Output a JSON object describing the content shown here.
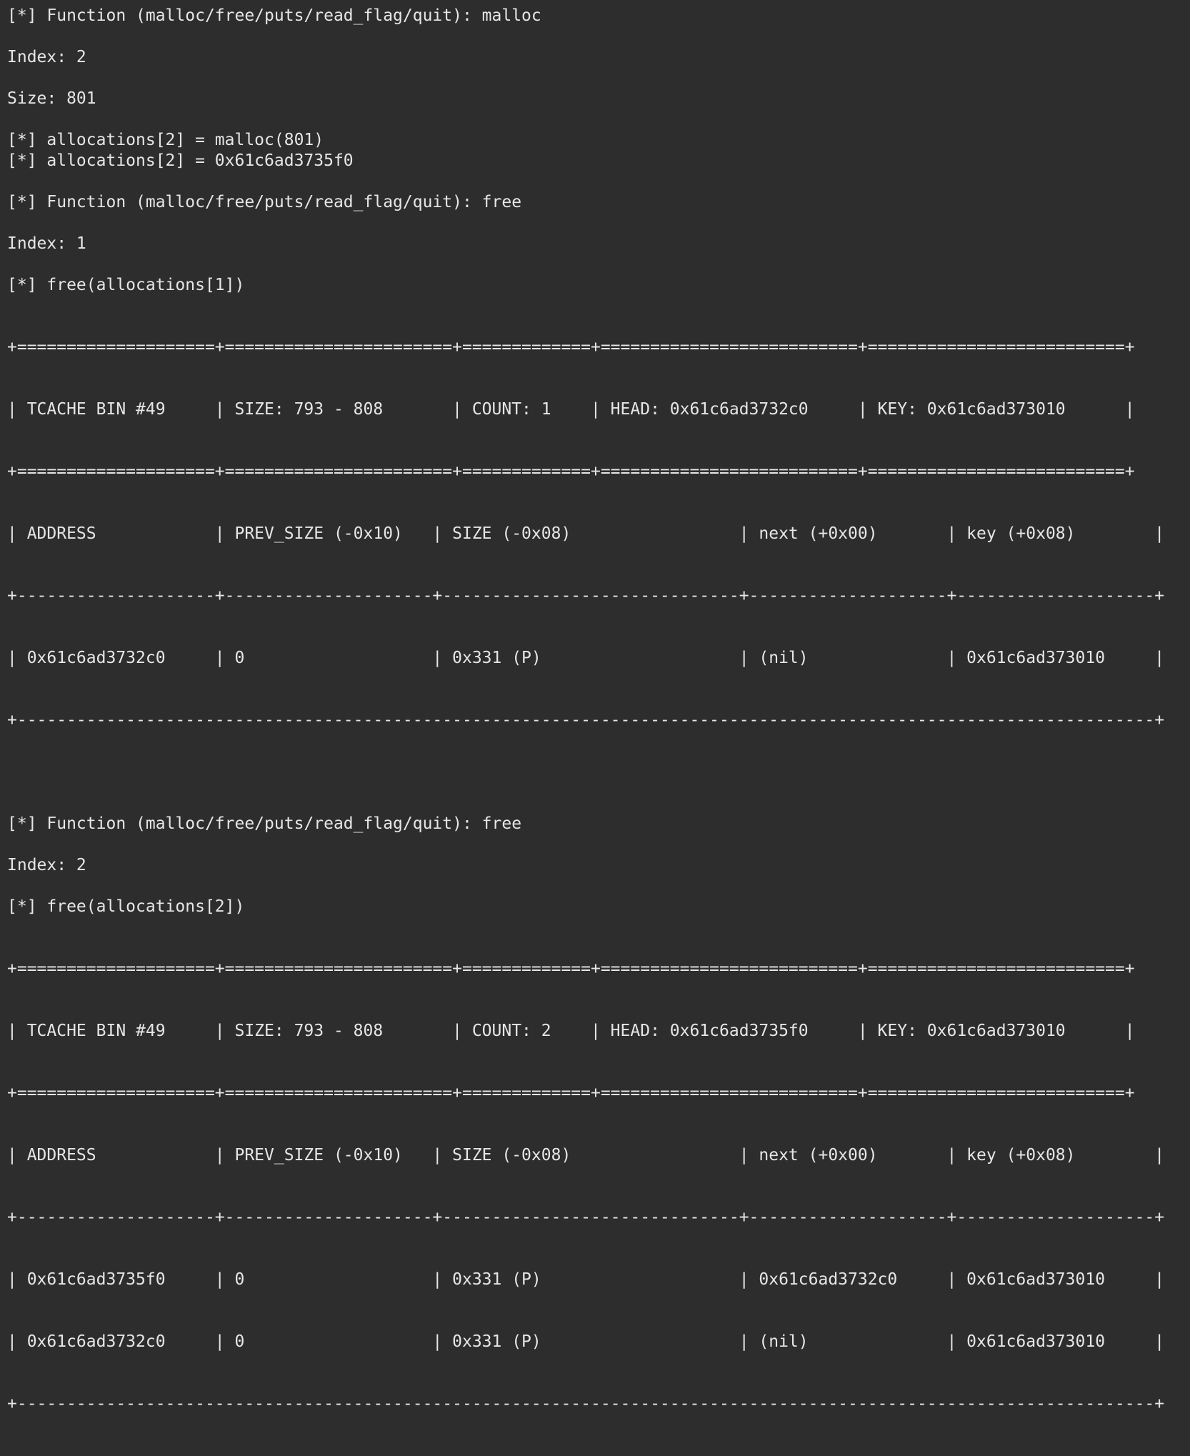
{
  "terminal": {
    "line1": "[*] Function (malloc/free/puts/read_flag/quit): malloc",
    "line2": "Index: 2",
    "line3": "Size: 801",
    "line4": "[*] allocations[2] = malloc(801)",
    "line5": "[*] allocations[2] = 0x61c6ad3735f0",
    "line6": "[*] Function (malloc/free/puts/read_flag/quit): free",
    "line7": "Index: 1",
    "line8": "[*] free(allocations[1])",
    "table1": {
      "border_eq": "+====================+=======================+=============+==========================+==========================+",
      "header": "| TCACHE BIN #49     | SIZE: 793 - 808       | COUNT: 1    | HEAD: 0x61c6ad3732c0     | KEY: 0x61c6ad373010      |",
      "border_eq2": "+====================+=======================+=============+==========================+==========================+",
      "colheader": "| ADDRESS            | PREV_SIZE (-0x10)   | SIZE (-0x08)                 | next (+0x00)       | key (+0x08)        |",
      "border_dash": "+--------------------+---------------------+------------------------------+--------------------+--------------------+",
      "rows": [
        "| 0x61c6ad3732c0     | 0                   | 0x331 (P)                    | (nil)              | 0x61c6ad373010     |"
      ],
      "border_end": "+-------------------------------------------------------------------------------------------------------------------+"
    },
    "line9": "[*] Function (malloc/free/puts/read_flag/quit): free",
    "line10": "Index: 2",
    "line11": "[*] free(allocations[2])",
    "table2": {
      "border_eq": "+====================+=======================+=============+==========================+==========================+",
      "header": "| TCACHE BIN #49     | SIZE: 793 - 808       | COUNT: 2    | HEAD: 0x61c6ad3735f0     | KEY: 0x61c6ad373010      |",
      "border_eq2": "+====================+=======================+=============+==========================+==========================+",
      "colheader": "| ADDRESS            | PREV_SIZE (-0x10)   | SIZE (-0x08)                 | next (+0x00)       | key (+0x08)        |",
      "border_dash": "+--------------------+---------------------+------------------------------+--------------------+--------------------+",
      "rows": [
        "| 0x61c6ad3735f0     | 0                   | 0x331 (P)                    | 0x61c6ad3732c0     | 0x61c6ad373010     |",
        "| 0x61c6ad3732c0     | 0                   | 0x331 (P)                    | (nil)              | 0x61c6ad373010     |"
      ],
      "border_end": "+-------------------------------------------------------------------------------------------------------------------+"
    }
  }
}
